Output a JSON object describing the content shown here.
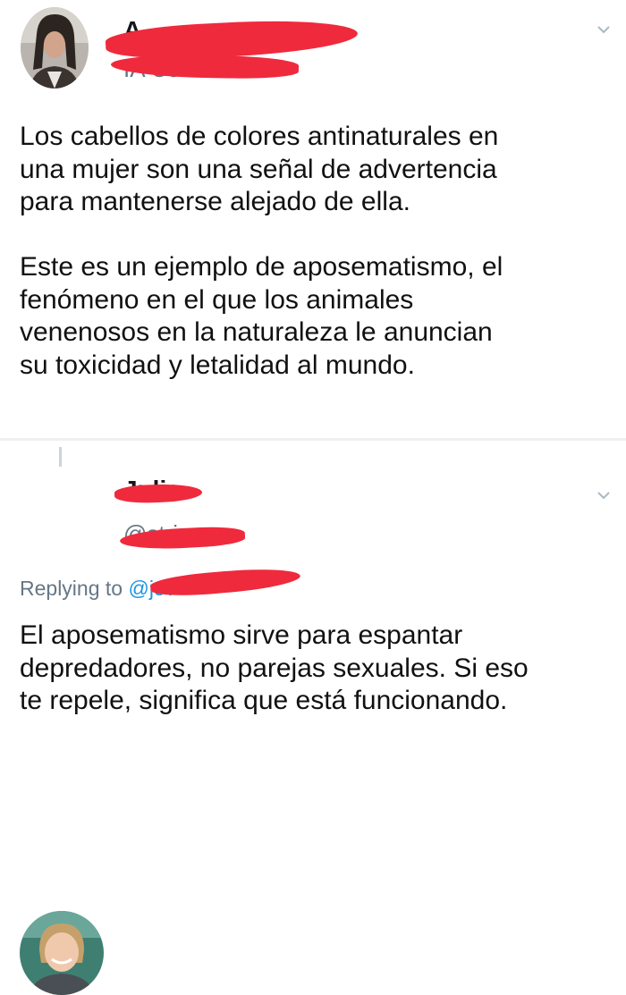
{
  "tweet1": {
    "author_name": "A",
    "author_handle": "IA Cortes",
    "text": "Los cabellos de colores antinaturales en\nuna mujer son una señal de advertencia\npara mantenerse alejado de ella.\n\nEste es un ejemplo de aposematismo, el\nfenómeno en el que los animales\nvenenosos en la naturaleza le anuncian\nsu toxicidad y letalidad al mundo.",
    "menu_icon": "chevron-down-icon"
  },
  "tweet2": {
    "author_name": "Julia",
    "author_handle": "@stringy",
    "replying_to_label": "Replying to",
    "replying_to_handle": "@jov",
    "text": "El aposematismo sirve para espantar\ndepredadores, no parejas sexuales. Si eso\nte repele, significa que está funcionando.",
    "menu_icon": "chevron-down-icon"
  },
  "colors": {
    "redaction": "#ef2a3d",
    "secondary_text": "#657786",
    "link": "#1b95e0",
    "separator": "#eef0f1"
  }
}
